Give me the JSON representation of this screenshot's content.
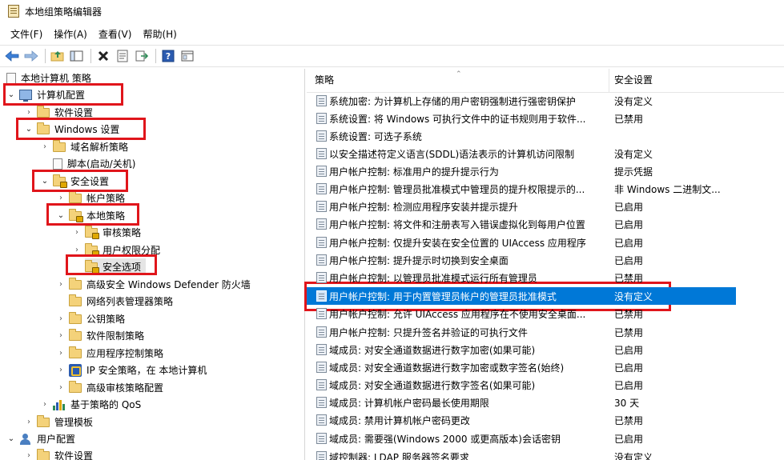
{
  "window": {
    "title": "本地组策略编辑器"
  },
  "menu": [
    "文件(F)",
    "操作(A)",
    "查看(V)",
    "帮助(H)"
  ],
  "toolbar": [
    "back-icon",
    "forward-icon",
    "up-folder-icon",
    "show-tree-icon",
    "delete-icon",
    "properties-icon",
    "export-icon",
    "help-icon",
    "view-icon"
  ],
  "tree": [
    {
      "label": "本地计算机 策略",
      "depth": 0,
      "icon": "doc-icon",
      "expander": "none"
    },
    {
      "label": "计算机配置",
      "depth": 0,
      "icon": "computer-icon",
      "expander": "expanded"
    },
    {
      "label": "软件设置",
      "depth": 1,
      "icon": "folder-icon",
      "expander": "collapsed"
    },
    {
      "label": "Windows 设置",
      "depth": 1,
      "icon": "folder-icon",
      "expander": "expanded"
    },
    {
      "label": "域名解析策略",
      "depth": 2,
      "icon": "folder-icon",
      "expander": "collapsed"
    },
    {
      "label": "脚本(启动/关机)",
      "depth": 2,
      "icon": "doc-icon",
      "expander": "none"
    },
    {
      "label": "安全设置",
      "depth": 2,
      "icon": "lock-folder-icon",
      "expander": "expanded"
    },
    {
      "label": "帐户策略",
      "depth": 3,
      "icon": "folder-icon",
      "expander": "collapsed"
    },
    {
      "label": "本地策略",
      "depth": 3,
      "icon": "lock-folder-icon",
      "expander": "expanded"
    },
    {
      "label": "审核策略",
      "depth": 4,
      "icon": "lock-folder-icon",
      "expander": "collapsed"
    },
    {
      "label": "用户权限分配",
      "depth": 4,
      "icon": "lock-folder-icon",
      "expander": "collapsed"
    },
    {
      "label": "安全选项",
      "depth": 4,
      "icon": "lock-folder-icon",
      "expander": "none"
    },
    {
      "label": "高级安全 Windows Defender 防火墙",
      "depth": 3,
      "icon": "folder-icon",
      "expander": "collapsed"
    },
    {
      "label": "网络列表管理器策略",
      "depth": 3,
      "icon": "folder-icon",
      "expander": "none"
    },
    {
      "label": "公钥策略",
      "depth": 3,
      "icon": "folder-icon",
      "expander": "collapsed"
    },
    {
      "label": "软件限制策略",
      "depth": 3,
      "icon": "folder-icon",
      "expander": "collapsed"
    },
    {
      "label": "应用程序控制策略",
      "depth": 3,
      "icon": "folder-icon",
      "expander": "collapsed"
    },
    {
      "label": "IP 安全策略，在 本地计算机",
      "depth": 3,
      "icon": "ip-security-icon",
      "expander": "collapsed"
    },
    {
      "label": "高级审核策略配置",
      "depth": 3,
      "icon": "folder-icon",
      "expander": "collapsed"
    },
    {
      "label": "基于策略的 QoS",
      "depth": 2,
      "icon": "qos-chart-icon",
      "expander": "collapsed"
    },
    {
      "label": "管理模板",
      "depth": 1,
      "icon": "folder-icon",
      "expander": "collapsed"
    },
    {
      "label": "用户配置",
      "depth": 0,
      "icon": "user-icon",
      "expander": "expanded"
    },
    {
      "label": "软件设置",
      "depth": 1,
      "icon": "folder-icon",
      "expander": "collapsed"
    }
  ],
  "columns": {
    "policy": "策略",
    "setting": "安全设置"
  },
  "policies": [
    {
      "name": "系统加密: 为计算机上存储的用户密钥强制进行强密钥保护",
      "setting": "没有定义"
    },
    {
      "name": "系统设置: 将 Windows 可执行文件中的证书规则用于软件...",
      "setting": "已禁用"
    },
    {
      "name": "系统设置: 可选子系统",
      "setting": ""
    },
    {
      "name": "以安全描述符定义语言(SDDL)语法表示的计算机访问限制",
      "setting": "没有定义"
    },
    {
      "name": "用户帐户控制: 标准用户的提升提示行为",
      "setting": "提示凭据"
    },
    {
      "name": "用户帐户控制: 管理员批准模式中管理员的提升权限提示的...",
      "setting": "非 Windows 二进制文..."
    },
    {
      "name": "用户帐户控制: 检测应用程序安装并提示提升",
      "setting": "已启用"
    },
    {
      "name": "用户帐户控制: 将文件和注册表写入错误虚拟化到每用户位置",
      "setting": "已启用"
    },
    {
      "name": "用户帐户控制: 仅提升安装在安全位置的 UIAccess 应用程序",
      "setting": "已启用"
    },
    {
      "name": "用户帐户控制: 提升提示时切换到安全桌面",
      "setting": "已启用"
    },
    {
      "name": "用户帐户控制: 以管理员批准模式运行所有管理员",
      "setting": "已禁用"
    },
    {
      "name": "用户帐户控制: 用于内置管理员帐户的管理员批准模式",
      "setting": "没有定义",
      "selected": true
    },
    {
      "name": "用户帐户控制: 允许 UIAccess 应用程序在不使用安全桌面...",
      "setting": "已禁用"
    },
    {
      "name": "用户帐户控制: 只提升签名并验证的可执行文件",
      "setting": "已禁用"
    },
    {
      "name": "域成员: 对安全通道数据进行数字加密(如果可能)",
      "setting": "已启用"
    },
    {
      "name": "域成员: 对安全通道数据进行数字加密或数字签名(始终)",
      "setting": "已启用"
    },
    {
      "name": "域成员: 对安全通道数据进行数字签名(如果可能)",
      "setting": "已启用"
    },
    {
      "name": "域成员: 计算机帐户密码最长使用期限",
      "setting": "30 天"
    },
    {
      "name": "域成员: 禁用计算机帐户密码更改",
      "setting": "已禁用"
    },
    {
      "name": "域成员: 需要强(Windows 2000 或更高版本)会话密钥",
      "setting": "已启用"
    },
    {
      "name": "域控制器: LDAP 服务器签名要求",
      "setting": "没有定义"
    }
  ],
  "colors": {
    "selection": "#0078d7",
    "highlight_box": "#e0151b"
  }
}
